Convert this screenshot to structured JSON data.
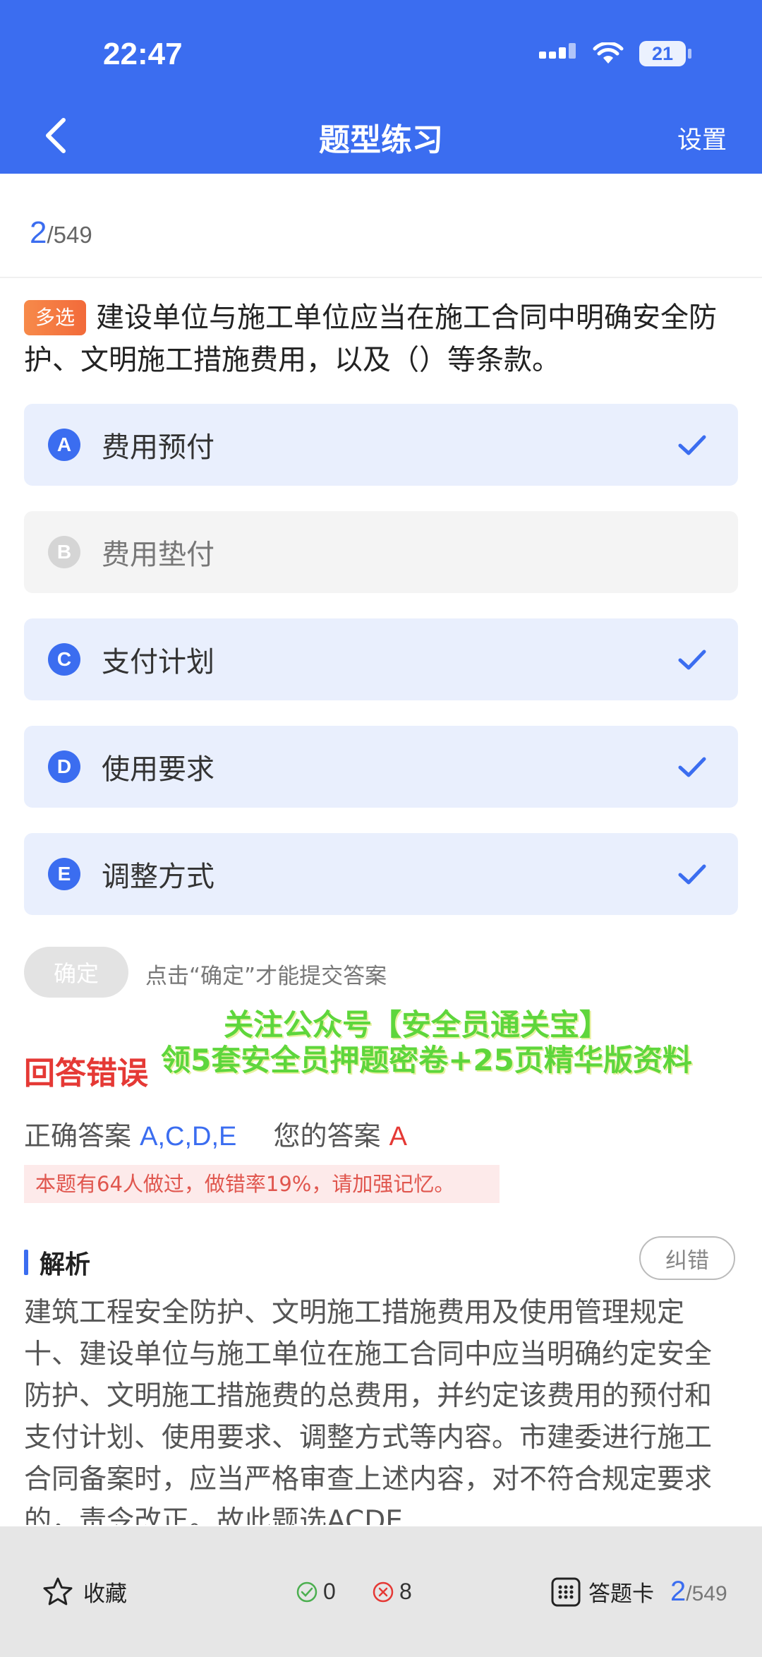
{
  "status_bar": {
    "time": "22:47",
    "battery": "21"
  },
  "header": {
    "title": "题型练习",
    "settings_label": "设置"
  },
  "progress": {
    "current": "2",
    "total": "/549"
  },
  "question": {
    "type_tag": "多选",
    "text": "建设单位与施工单位应当在施工合同中明确安全防护、文明施工措施费用，以及（）等条款。"
  },
  "options": [
    {
      "letter": "A",
      "text": "费用预付",
      "selected": true
    },
    {
      "letter": "B",
      "text": "费用垫付",
      "selected": false
    },
    {
      "letter": "C",
      "text": "支付计划",
      "selected": true
    },
    {
      "letter": "D",
      "text": "使用要求",
      "selected": true
    },
    {
      "letter": "E",
      "text": "调整方式",
      "selected": true
    }
  ],
  "confirm": {
    "label": "确定",
    "hint": "点击“确定”才能提交答案"
  },
  "promo": {
    "line1": "关注公众号【安全员通关宝】",
    "line2": "领5套安全员押题密卷+25页精华版资料"
  },
  "result": {
    "status": "回答错误",
    "correct_label": "正确答案",
    "correct_value": "A,C,D,E",
    "your_label": "您的答案",
    "your_value": "A",
    "stat_text": "本题有64人做过，做错率19%，请加强记忆。"
  },
  "analysis": {
    "title": "解析",
    "report_button": "纠错",
    "text": "建筑工程安全防护、文明施工措施费用及使用管理规定十、建设单位与施工单位在施工合同中应当明确约定安全防护、文明施工措施费的总费用，并约定该费用的预付和支付计划、使用要求、调整方式等内容。市建委进行施工合同备案时，应当严格审查上述内容，对不符合规定要求的，责令改正。故此题选ACDE"
  },
  "bottom_bar": {
    "favorite_label": "收藏",
    "correct_count": "0",
    "wrong_count": "8",
    "answer_card_label": "答题卡",
    "current": "2",
    "total": "/549"
  },
  "colors": {
    "primary": "#3b6df0",
    "error": "#e53935",
    "promo": "#5ed63c"
  }
}
